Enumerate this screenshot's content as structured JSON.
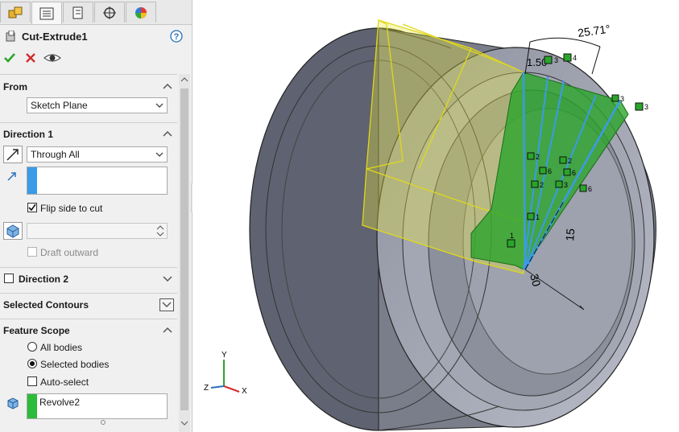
{
  "feature": {
    "title": "Cut-Extrude1"
  },
  "sections": {
    "from": {
      "title": "From",
      "option": "Sketch Plane"
    },
    "direction1": {
      "title": "Direction 1",
      "end_condition": "Through All",
      "flip_label": "Flip side to cut",
      "draft_label": "Draft outward"
    },
    "direction2": {
      "title": "Direction 2"
    },
    "selected_contours": {
      "title": "Selected Contours"
    },
    "feature_scope": {
      "title": "Feature Scope",
      "all_bodies": "All bodies",
      "selected_bodies": "Selected bodies",
      "auto_select": "Auto-select",
      "body": "Revolve2"
    }
  },
  "dimensions": {
    "angle": "25.71°",
    "dim_1": "1.50",
    "dim_15": "15",
    "dim_30": "30"
  },
  "relation_marks": [
    "3",
    "4",
    "3",
    "1",
    "2",
    "6",
    "2",
    "6",
    "3",
    "6",
    "2",
    "3",
    "1"
  ],
  "triad": {
    "x": "X",
    "y": "Y",
    "z": "Z"
  },
  "colors": {
    "accent_green": "#2aa52a",
    "selection_blue": "#3a9be8",
    "sketch_yellow": "#e8e838"
  }
}
